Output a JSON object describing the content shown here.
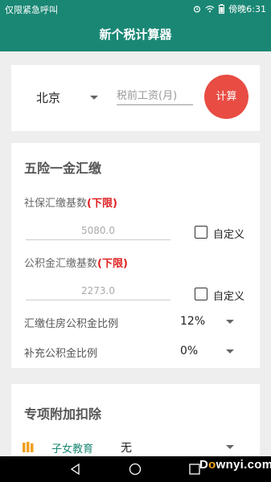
{
  "status_bar": {
    "left_text": "仅限紧急呼叫",
    "time": "傍晚6:31",
    "icons": [
      "alarm-icon",
      "wifi-icon",
      "battery-icon"
    ]
  },
  "app_bar": {
    "title": "新个税计算器"
  },
  "calc_card": {
    "city": "北京",
    "salary_placeholder": "税前工资(月)",
    "calc_button": "计算"
  },
  "insurance": {
    "title": "五险一金汇缴",
    "social_base_label": "社保汇缴基数",
    "social_base_limit": "(下限)",
    "social_base_value": "5080.0",
    "social_custom_label": "自定义",
    "fund_base_label": "公积金汇缴基数",
    "fund_base_limit": "(下限)",
    "fund_base_value": "2273.0",
    "fund_custom_label": "自定义",
    "fund_ratio_label": "汇缴住房公积金比例",
    "fund_ratio_value": "12%",
    "extra_fund_ratio_label": "补充公积金比例",
    "extra_fund_ratio_value": "0%"
  },
  "deductions": {
    "title": "专项附加扣除",
    "child_edu_label": "子女教育",
    "child_edu_value": "无"
  },
  "watermark": {
    "text_before": "D",
    "dot": "o",
    "text_after": "wnyi.com"
  },
  "colors": {
    "primary": "#1a8774",
    "accent": "#e84c43",
    "limit": "#e02020"
  }
}
